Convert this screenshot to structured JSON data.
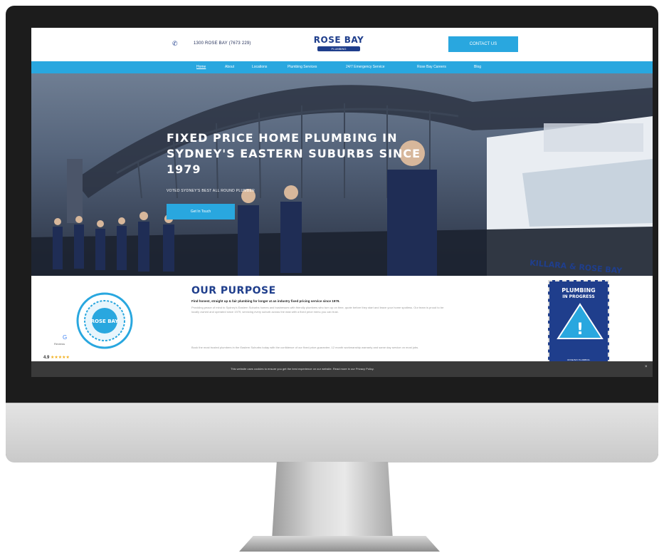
{
  "header": {
    "phone_icon": "phone-icon",
    "phone_number": "1300 ROSE BAY (7673 229)",
    "logo_main": "ROSE BAY",
    "logo_sub": "PLUMBING",
    "contact_label": "CONTACT US"
  },
  "nav": {
    "items": [
      "Home",
      "About",
      "Locations",
      "Plumbing Services",
      "24/7 Emergency Service",
      "Rose Bay Careers",
      "Blog"
    ]
  },
  "hero": {
    "title": "FIXED PRICE HOME PLUMBING IN SYDNEY'S EASTERN SUBURBS SINCE 1979",
    "subtitle": "VOTED SYDNEY'S BEST ALL ROUND PLUMBER",
    "button_label": "Get In Touch",
    "van_text": "KILLARA & ROSE BAY"
  },
  "purpose": {
    "title": "OUR PURPOSE",
    "lead": "Find honest, straight up & fair plumbing for longer at an industry fixed pricing service since 1979.",
    "body1": "Providing peace of mind to Sydney's Eastern Suburbs homes and businesses with friendly plumbers who turn up on time, quote before they start and leave your home spotless. Our team is proud to be locally owned and operated since 1979, servicing every suburb across the east with a fixed price menu you can trust.",
    "body2": "Book the most trusted plumbers in the Eastern Suburbs today with the confidence of our fixed price guarantee, 12 month workmanship warranty and same day service on most jobs.",
    "rating": "4.9",
    "stars": "★★★★★",
    "google_logo": "G",
    "google_label": "Reviews",
    "badge_text": "ROSE BAY",
    "poster_title_1": "PLUMBING",
    "poster_title_2": "IN PROGRESS",
    "poster_icon": "!",
    "poster_foot": "ROSE BAY PLUMBING"
  },
  "cookie": {
    "text": "This website uses cookies to ensure you get the best experience on our website. Read more in our Privacy Policy.",
    "close": "×"
  },
  "colors": {
    "brand_blue": "#1f3e8c",
    "accent": "#29a7df"
  }
}
